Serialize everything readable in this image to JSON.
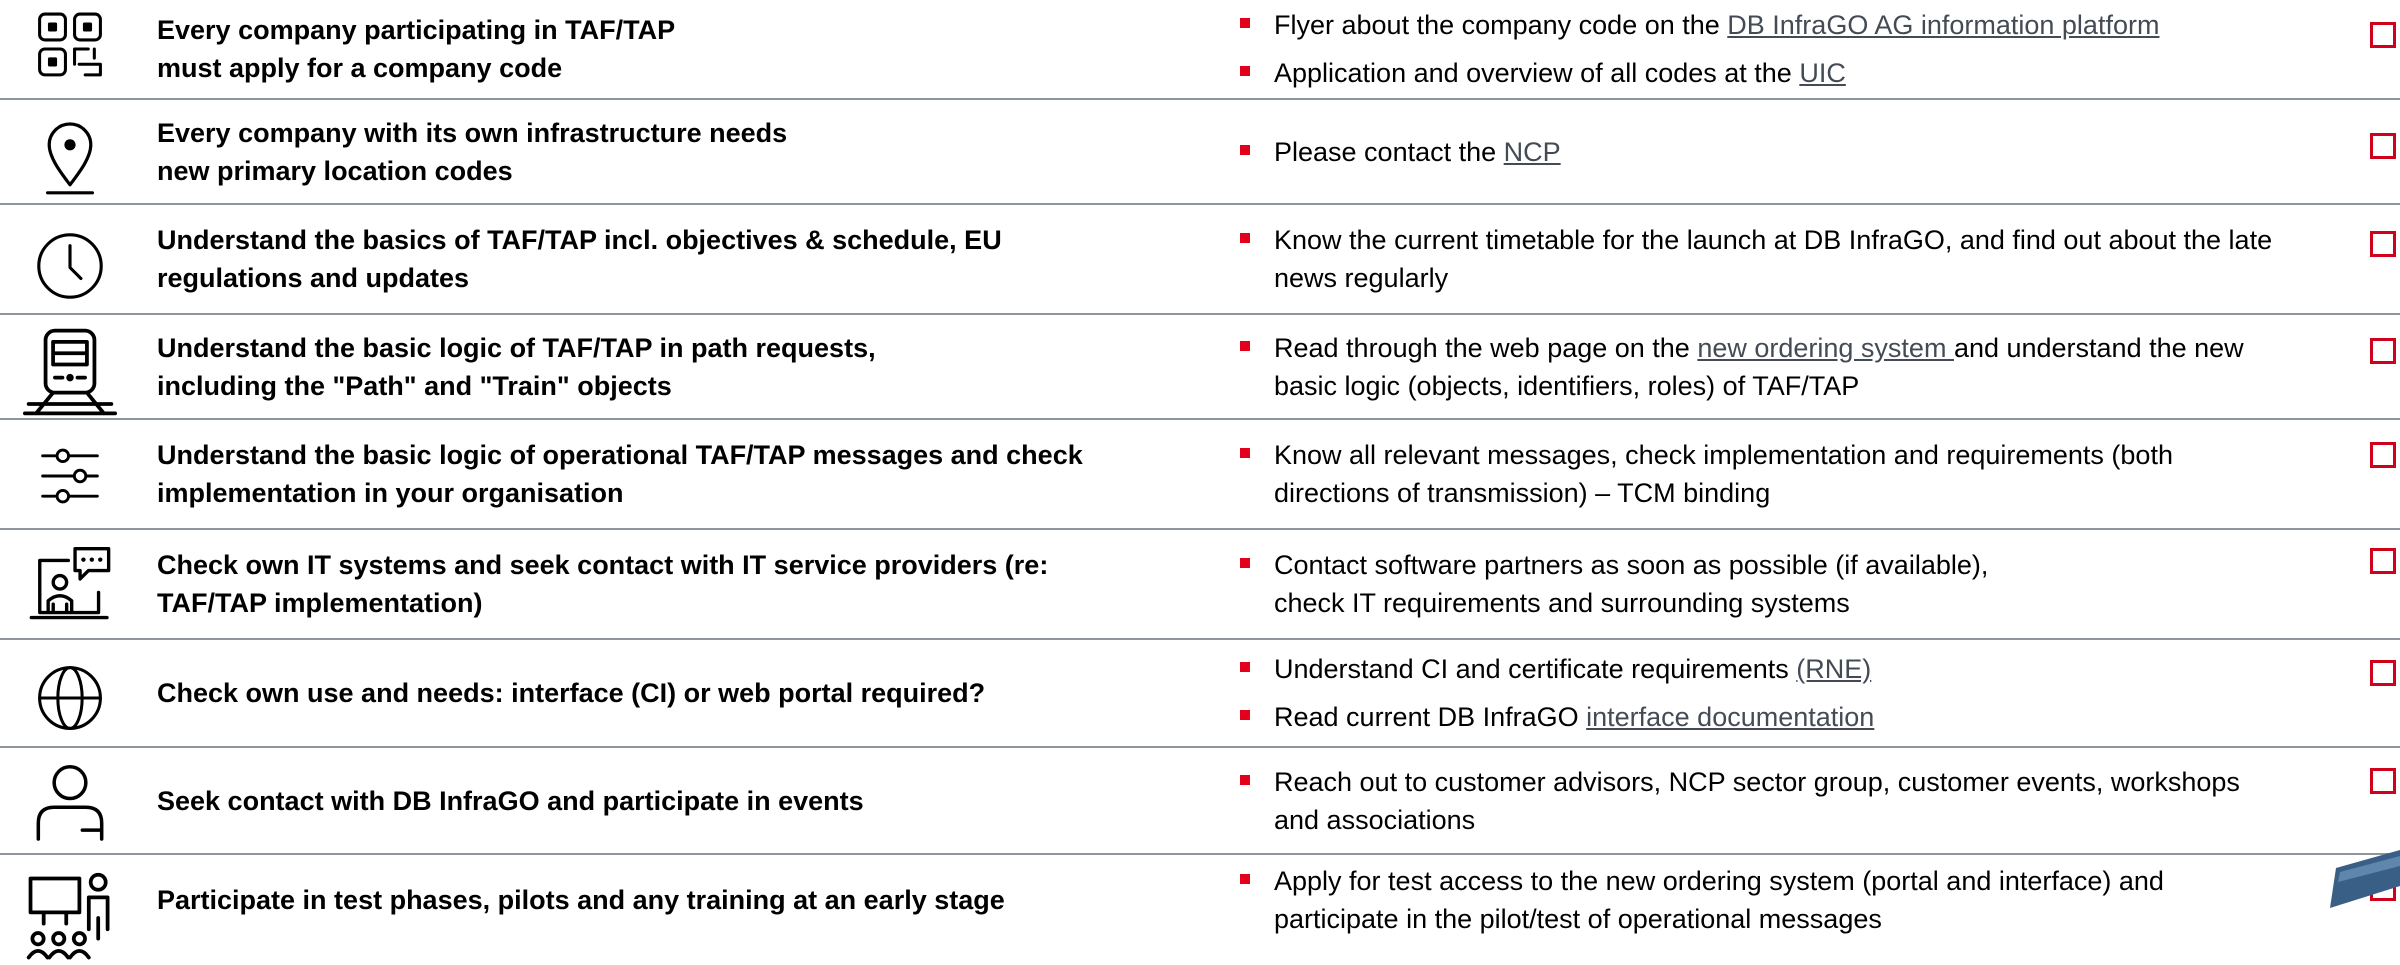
{
  "colors": {
    "bullet": "#e2001a",
    "checkbox_border": "#d0021b",
    "divider": "#8f959c",
    "link": "#444b55"
  },
  "rows": [
    {
      "icon": "qr-code-icon",
      "task_lines": [
        "Every company participating in TAF/TAP",
        "must apply for a company code"
      ],
      "notes": [
        [
          [
            {
              "t": "Flyer about the company code on the "
            },
            {
              "t": "DB InfraGO AG information platform",
              "link": true
            }
          ]
        ],
        [
          [
            {
              "t": "Application and overview of all codes at the "
            },
            {
              "t": "UIC",
              "link": true
            }
          ]
        ]
      ]
    },
    {
      "icon": "location-pin-icon",
      "task_lines": [
        "Every company with its own infrastructure needs",
        "new primary location codes"
      ],
      "notes": [
        [
          [
            {
              "t": "Please contact the "
            },
            {
              "t": "NCP",
              "link": true
            }
          ]
        ]
      ]
    },
    {
      "icon": "clock-icon",
      "task_lines": [
        "Understand the basics of TAF/TAP incl. objectives & schedule, EU",
        "regulations and updates"
      ],
      "notes": [
        [
          [
            {
              "t": "Know the current timetable for the launch at DB InfraGO, and find out about the late"
            }
          ],
          [
            {
              "t": "news regularly"
            }
          ]
        ]
      ]
    },
    {
      "icon": "train-icon",
      "task_lines": [
        "Understand the basic logic of TAF/TAP in path requests,",
        "including the \"Path\" and \"Train\" objects"
      ],
      "notes": [
        [
          [
            {
              "t": "Read through the web page on the "
            },
            {
              "t": "new ordering system ",
              "link": true
            },
            {
              "t": "and understand the new"
            }
          ],
          [
            {
              "t": "basic logic (objects, identifiers, roles) of TAF/TAP"
            }
          ]
        ]
      ]
    },
    {
      "icon": "sliders-icon",
      "task_lines": [
        "Understand the basic logic of operational TAF/TAP messages and check",
        "implementation in your organisation"
      ],
      "notes": [
        [
          [
            {
              "t": "Know all relevant messages, check implementation and requirements (both"
            }
          ],
          [
            {
              "t": "directions of transmission) – TCM binding"
            }
          ]
        ]
      ]
    },
    {
      "icon": "it-support-icon",
      "task_lines": [
        "Check own IT systems and seek contact with IT service providers (re:",
        "TAF/TAP implementation)"
      ],
      "notes": [
        [
          [
            {
              "t": "Contact software partners as soon as possible (if available),"
            }
          ],
          [
            {
              "t": "check IT requirements and surrounding systems"
            }
          ]
        ]
      ]
    },
    {
      "icon": "globe-icon",
      "task_lines": [
        "Check own use and needs: interface (CI) or web portal required?"
      ],
      "notes": [
        [
          [
            {
              "t": "Understand CI and certificate requirements "
            },
            {
              "t": "(RNE)",
              "link": true
            }
          ]
        ],
        [
          [
            {
              "t": "Read current DB InfraGO "
            },
            {
              "t": "interface documentation",
              "link": true
            }
          ]
        ]
      ]
    },
    {
      "icon": "person-icon",
      "task_lines": [
        "Seek contact with DB InfraGO and participate in events"
      ],
      "notes": [
        [
          [
            {
              "t": "Reach out to customer advisors, NCP sector group, customer events, workshops"
            }
          ],
          [
            {
              "t": "and associations"
            }
          ]
        ]
      ]
    },
    {
      "icon": "training-presentation-icon",
      "task_lines": [
        "Participate in test phases, pilots and any training at an early stage"
      ],
      "notes": [
        [
          [
            {
              "t": "Apply for test access to the new ordering system (portal and interface) and"
            }
          ],
          [
            {
              "t": "participate in the pilot/test of operational messages"
            }
          ]
        ]
      ]
    }
  ]
}
